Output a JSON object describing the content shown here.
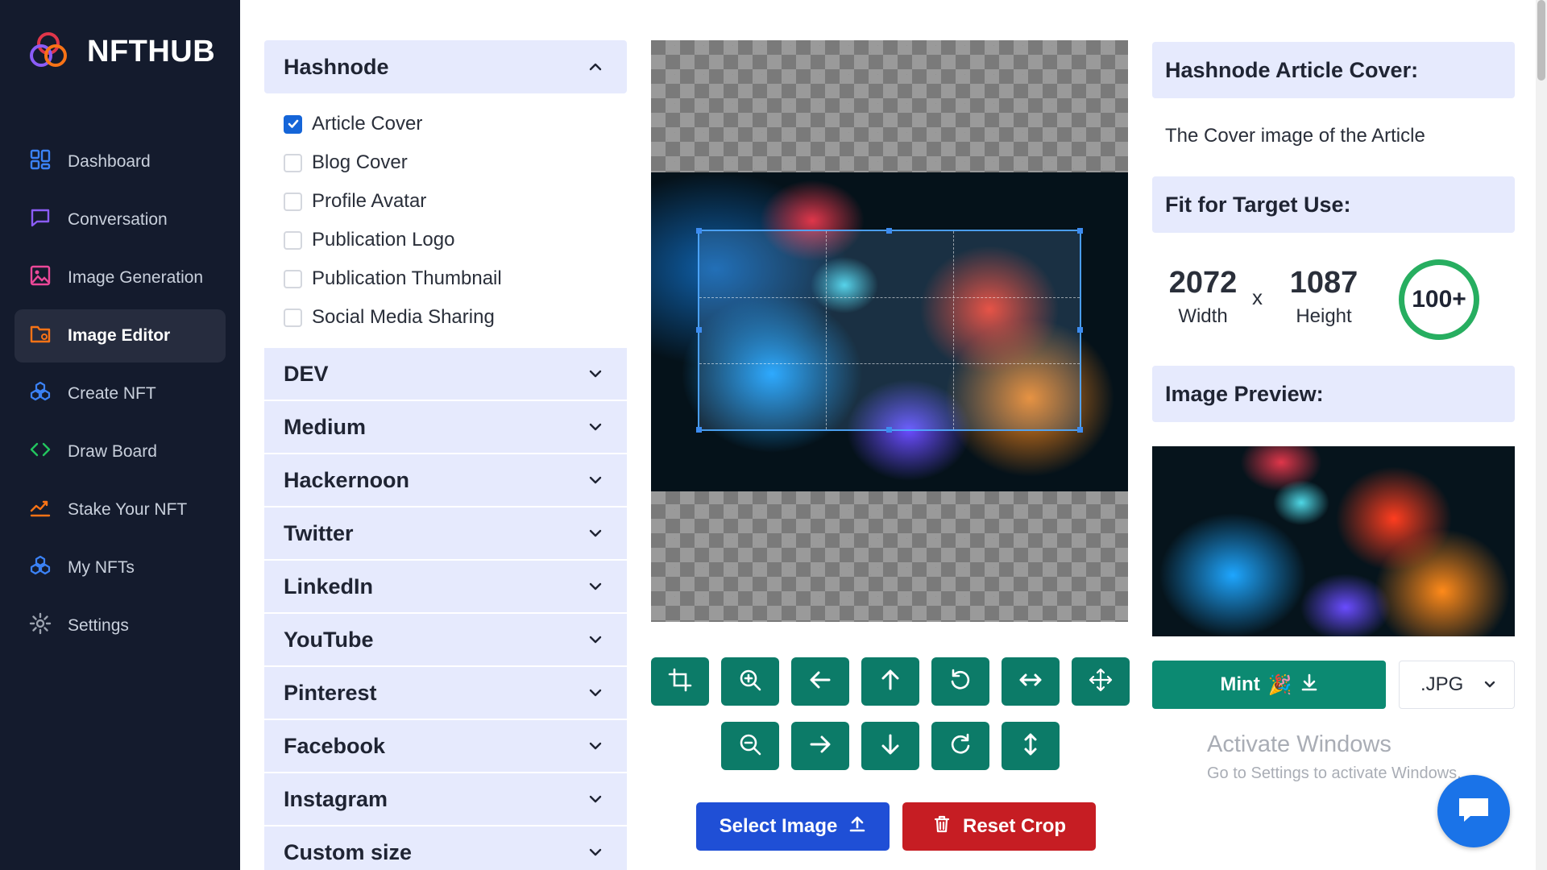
{
  "brand": {
    "name": "NFTHUB"
  },
  "sidebar": {
    "items": [
      {
        "label": "Dashboard",
        "icon": "grid-icon",
        "color": "#3b82f6"
      },
      {
        "label": "Conversation",
        "icon": "chat-icon",
        "color": "#8b5cf6"
      },
      {
        "label": "Image Generation",
        "icon": "image-icon",
        "color": "#ec4899"
      },
      {
        "label": "Image Editor",
        "icon": "folder-gear-icon",
        "color": "#f97316",
        "active": true
      },
      {
        "label": "Create NFT",
        "icon": "cubes-icon",
        "color": "#3b82f6"
      },
      {
        "label": "Draw Board",
        "icon": "code-icon",
        "color": "#22c55e"
      },
      {
        "label": "Stake Your NFT",
        "icon": "stake-icon",
        "color": "#f97316"
      },
      {
        "label": "My NFTs",
        "icon": "cubes-icon",
        "color": "#3b82f6"
      },
      {
        "label": "Settings",
        "icon": "gear-icon",
        "color": "#9ca3af"
      }
    ]
  },
  "platforms": {
    "expanded": {
      "label": "Hashnode",
      "options": [
        {
          "label": "Article Cover",
          "checked": true
        },
        {
          "label": "Blog Cover",
          "checked": false
        },
        {
          "label": "Profile Avatar",
          "checked": false
        },
        {
          "label": "Publication Logo",
          "checked": false
        },
        {
          "label": "Publication Thumbnail",
          "checked": false
        },
        {
          "label": "Social Media Sharing",
          "checked": false
        }
      ]
    },
    "collapsed": [
      "DEV",
      "Medium",
      "Hackernoon",
      "Twitter",
      "LinkedIn",
      "YouTube",
      "Pinterest",
      "Facebook",
      "Instagram",
      "Custom size"
    ]
  },
  "tools": {
    "row1": [
      "crop-icon",
      "zoom-in-icon",
      "arrow-left-icon",
      "arrow-up-icon",
      "rotate-left-icon",
      "flip-horizontal-icon",
      "move-icon"
    ],
    "row2": [
      "zoom-out-icon",
      "arrow-right-icon",
      "arrow-down-icon",
      "rotate-right-icon",
      "flip-vertical-icon"
    ]
  },
  "actions": {
    "select_image": "Select Image",
    "reset_crop": "Reset Crop"
  },
  "info": {
    "title": "Hashnode Article Cover:",
    "description": "The Cover image of the Article",
    "fit_title": "Fit for Target Use:",
    "width_value": "2072",
    "width_label": "Width",
    "times": "x",
    "height_value": "1087",
    "height_label": "Height",
    "score": "100+",
    "preview_title": "Image Preview:"
  },
  "mint": {
    "label": "Mint",
    "emoji": "🎉"
  },
  "format": {
    "selected": ".JPG"
  },
  "watermark": {
    "line1": "Activate Windows",
    "line2": "Go to Settings to activate Windows."
  },
  "colors": {
    "sidebar_bg": "#141b2d",
    "accent_green": "#0c7b68",
    "select_blue": "#1f4fd6",
    "reset_red": "#c61d23",
    "panel_bg": "#e6eafd",
    "score_ring": "#27ae60"
  }
}
